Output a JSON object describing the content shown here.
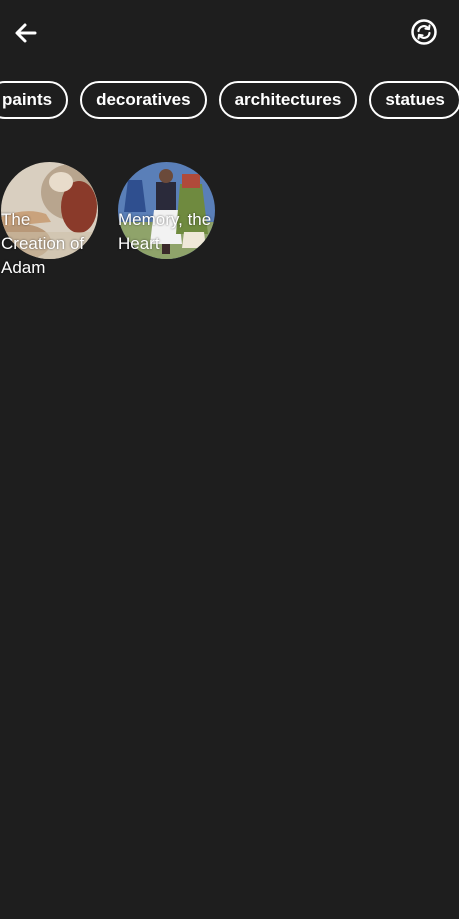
{
  "header": {
    "back_icon": "arrow-left-icon",
    "sync_icon": "sync-circle-icon"
  },
  "categories": [
    {
      "label": "paints"
    },
    {
      "label": "decoratives"
    },
    {
      "label": "architectures"
    },
    {
      "label": "statues"
    }
  ],
  "artworks": [
    {
      "title": "The Creation of Adam"
    },
    {
      "title": "Memory, the Heart"
    }
  ],
  "colors": {
    "background": "#1e1e1e",
    "foreground": "#ffffff"
  }
}
